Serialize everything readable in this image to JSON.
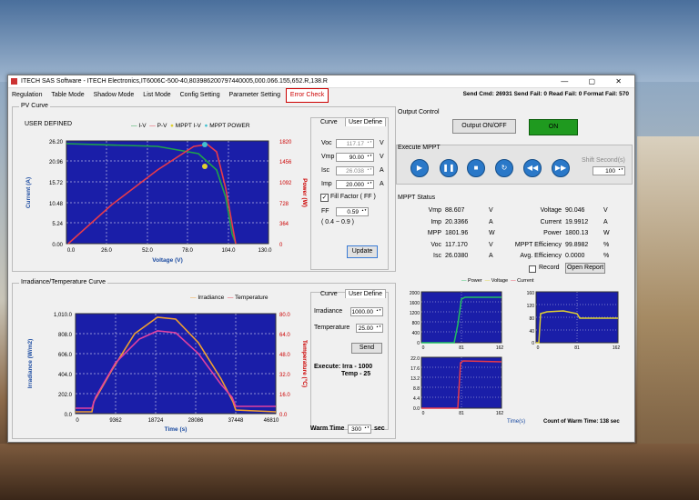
{
  "window": {
    "title": "ITECH SAS Software - ITECH Electronics,IT6006C-500-40,803986200797440005,000.066.155,652.R,138.R",
    "controls": "—  ▢  ✕"
  },
  "menu": [
    "Regulation",
    "Table Mode",
    "Shadow Mode",
    "List Mode",
    "Config Setting",
    "Parameter Setting",
    "Error Check"
  ],
  "status": "Send Cmd: 26931  Send Fail: 0  Read Fail: 0  Format Fail: 570",
  "pv_curve": {
    "section_title": "PV Curve",
    "mode": "USER DEFINED",
    "legend": [
      "I-V",
      "P-V",
      "MPPT I-V",
      "MPPT POWER"
    ],
    "y_left_label": "Current (A)",
    "y_right_label": "Power (W)",
    "x_label": "Voltage (V)",
    "y_left_ticks": [
      "26.20",
      "20.96",
      "15.72",
      "10.48",
      "5.24",
      "0.00"
    ],
    "y_right_ticks": [
      "1820",
      "1456",
      "1092",
      "728",
      "364",
      "0"
    ],
    "x_ticks": [
      "0.0",
      "26.0",
      "52.0",
      "78.0",
      "104.0",
      "130.0"
    ]
  },
  "curve_panel": {
    "tab1": "Curve",
    "tab2": "User Define",
    "voc_label": "Voc",
    "voc_value": "117.17",
    "voc_unit": "V",
    "vmp_label": "Vmp",
    "vmp_value": "90.00",
    "vmp_unit": "V",
    "isc_label": "Isc",
    "isc_value": "26.038",
    "isc_unit": "A",
    "imp_label": "Imp",
    "imp_value": "20.000",
    "imp_unit": "A",
    "ff_check": "Fill Factor ( FF )",
    "ff_label": "FF",
    "ff_value": "0.59",
    "ff_range": "( 0.4 ~ 0.9 )",
    "update": "Update"
  },
  "output_control": {
    "title": "Output Control",
    "onoff": "Output ON/OFF",
    "state": "ON"
  },
  "execute_mppt": {
    "title": "Execute MPPT",
    "shift_label": "Shift Second(s)",
    "shift_value": "100",
    "buttons": [
      "play",
      "pause",
      "stop",
      "refresh",
      "rewind",
      "fast-forward"
    ]
  },
  "mppt_status": {
    "title": "MPPT Status",
    "left": [
      {
        "k": "Vmp",
        "v": "88.607",
        "u": "V"
      },
      {
        "k": "Imp",
        "v": "20.3366",
        "u": "A"
      },
      {
        "k": "MPP",
        "v": "1801.96",
        "u": "W"
      },
      {
        "k": "Voc",
        "v": "117.170",
        "u": "V"
      },
      {
        "k": "Isc",
        "v": "26.0380",
        "u": "A"
      }
    ],
    "right": [
      {
        "k": "Voltage",
        "v": "90.046",
        "u": "V"
      },
      {
        "k": "Current",
        "v": "19.9912",
        "u": "A"
      },
      {
        "k": "Power",
        "v": "1800.13",
        "u": "W"
      },
      {
        "k": "MPPT Efficiency",
        "v": "99.8982",
        "u": "%"
      },
      {
        "k": "Avg. Efficiency",
        "v": "0.0000",
        "u": "%"
      }
    ],
    "record": "Record",
    "open_report": "Open Report"
  },
  "mini_charts": {
    "legend": [
      "Power",
      "Voltage",
      "Current"
    ],
    "power_ticks": [
      "2000",
      "1600",
      "1200",
      "800",
      "400",
      "0"
    ],
    "voltage_ticks": [
      "160",
      "120",
      "80",
      "40",
      "0"
    ],
    "current_ticks": [
      "22.0",
      "17.6",
      "13.2",
      "8.8",
      "4.4",
      "0.0"
    ],
    "x_ticks": [
      "0",
      "81",
      "162"
    ],
    "time_label": "Time(s)",
    "warm_count": "Count of Warm Time: 138 sec"
  },
  "irr_temp": {
    "section_title": "Irradiance/Temperature Curve",
    "legend": [
      "Irradiance",
      "Temperature"
    ],
    "y_left_label": "Irradiance (W/m2)",
    "y_right_label": "Temperature (°C)",
    "x_label": "Time (s)",
    "y_left_ticks": [
      "1,010.0",
      "808.0",
      "606.0",
      "404.0",
      "202.0",
      "0.0"
    ],
    "y_right_ticks": [
      "80.0",
      "64.0",
      "48.0",
      "32.0",
      "16.0",
      "0.0"
    ],
    "x_ticks": [
      "0",
      "9362",
      "18724",
      "28086",
      "37448",
      "46810"
    ],
    "tab1": "Curve",
    "tab2": "User Define",
    "irr_label": "Irradiance",
    "irr_value": "1000.00",
    "temp_label": "Temperature",
    "temp_value": "25.00",
    "send": "Send",
    "execute_line1": "Execute: Irra - 1000",
    "execute_line2": "Temp - 25",
    "warm_label": "Warm Time",
    "warm_value": "300",
    "warm_unit": "sec"
  },
  "colors": {
    "plot_bg": "#1a1ea8",
    "iv": "#1fa34a",
    "pv": "#e83a4a",
    "irr": "#f0a030",
    "temp": "#e040a0",
    "on_green": "#1f9a1f"
  }
}
